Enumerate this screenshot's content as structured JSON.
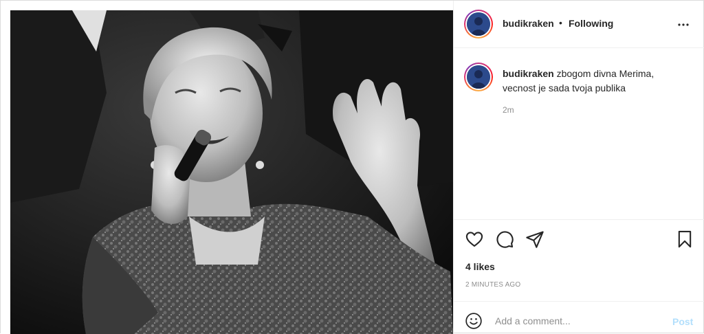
{
  "header": {
    "username": "budikraken",
    "separator": "•",
    "follow_status": "Following",
    "more_icon": "more-horizontal-icon"
  },
  "caption": {
    "username": "budikraken",
    "text": "zbogom divna Merima, vecnost je sada tvoja publika",
    "time": "2m"
  },
  "actions": {
    "icons": [
      "heart-icon",
      "comment-icon",
      "share-icon",
      "bookmark-icon"
    ],
    "likes": "4 likes",
    "timestamp": "2 MINUTES AGO"
  },
  "comment_box": {
    "placeholder": "Add a comment...",
    "post_label": "Post",
    "emoji_icon": "emoji-icon"
  },
  "colors": {
    "post_button_disabled": "#b2dffc",
    "muted_text": "#8e8e8e",
    "border": "#dbdbdb"
  }
}
